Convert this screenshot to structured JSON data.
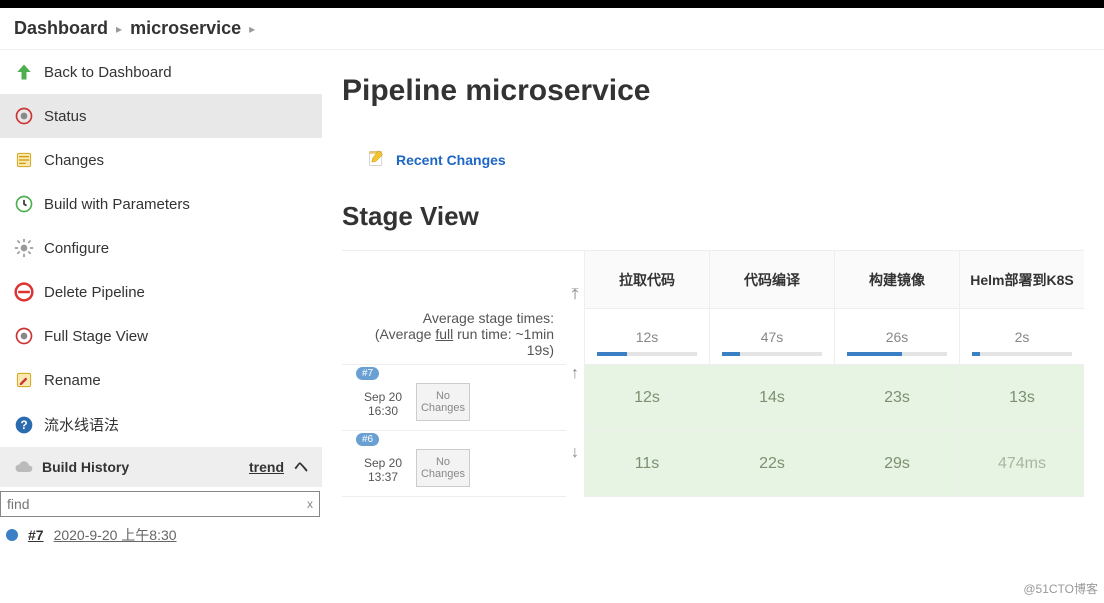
{
  "breadcrumb": {
    "dashboard": "Dashboard",
    "project": "microservice"
  },
  "sidebar": {
    "items": [
      {
        "label": "Back to Dashboard",
        "icon": "up-arrow-icon"
      },
      {
        "label": "Status",
        "icon": "status-icon"
      },
      {
        "label": "Changes",
        "icon": "changes-icon"
      },
      {
        "label": "Build with Parameters",
        "icon": "clock-icon"
      },
      {
        "label": "Configure",
        "icon": "gear-icon"
      },
      {
        "label": "Delete Pipeline",
        "icon": "delete-icon"
      },
      {
        "label": "Full Stage View",
        "icon": "stageview-icon"
      },
      {
        "label": "Rename",
        "icon": "rename-icon"
      },
      {
        "label": "流水线语法",
        "icon": "help-icon"
      }
    ],
    "build_history": {
      "title": "Build History",
      "trend_label": "trend",
      "find_placeholder": "find",
      "builds": [
        {
          "num": "#7",
          "date": "2020-9-20 上午8:30"
        }
      ]
    }
  },
  "main": {
    "title": "Pipeline microservice",
    "recent_changes": "Recent Changes",
    "stage_view_title": "Stage View",
    "avg_line1": "Average stage times:",
    "avg_line2_pre": "(Average ",
    "avg_line2_full": "full",
    "avg_line2_post": " run time: ~1min",
    "avg_line3": "19s)",
    "columns": [
      {
        "name": "拉取代码",
        "avg": "12s",
        "fill": 30
      },
      {
        "name": "代码编译",
        "avg": "47s",
        "fill": 18
      },
      {
        "name": "构建镜像",
        "avg": "26s",
        "fill": 55
      },
      {
        "name": "Helm部署到K8S",
        "avg": "2s",
        "fill": 8
      }
    ],
    "runs": [
      {
        "badge": "#7",
        "date": "Sep 20",
        "time": "16:30",
        "changes": "No Changes",
        "cells": [
          "12s",
          "14s",
          "23s",
          "13s"
        ],
        "dim": [
          false,
          false,
          false,
          false
        ]
      },
      {
        "badge": "#6",
        "date": "Sep 20",
        "time": "13:37",
        "changes": "No Changes",
        "cells": [
          "11s",
          "22s",
          "29s",
          "474ms"
        ],
        "dim": [
          false,
          false,
          false,
          true
        ]
      }
    ]
  },
  "watermark": "@51CTO博客"
}
